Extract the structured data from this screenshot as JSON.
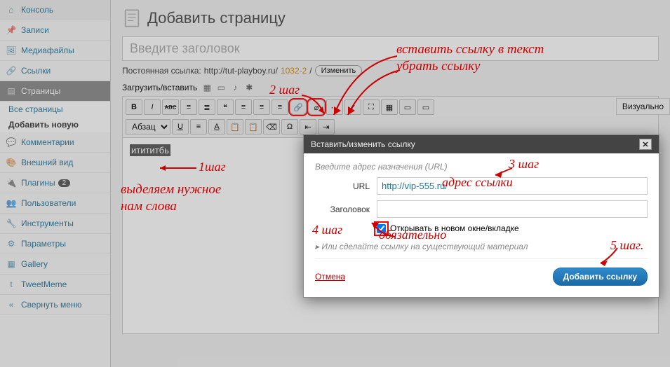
{
  "sidebar": {
    "items": [
      {
        "label": "Консоль",
        "icon": "dashboard"
      },
      {
        "label": "Записи",
        "icon": "pin"
      },
      {
        "label": "Медиафайлы",
        "icon": "media"
      },
      {
        "label": "Ссылки",
        "icon": "link"
      },
      {
        "label": "Страницы",
        "icon": "page",
        "active": true
      },
      {
        "label": "Комментарии",
        "icon": "comment"
      },
      {
        "label": "Внешний вид",
        "icon": "appearance"
      },
      {
        "label": "Плагины",
        "icon": "plugin",
        "badge": "2"
      },
      {
        "label": "Пользователи",
        "icon": "users"
      },
      {
        "label": "Инструменты",
        "icon": "tools"
      },
      {
        "label": "Параметры",
        "icon": "settings"
      },
      {
        "label": "Gallery",
        "icon": "gallery"
      },
      {
        "label": "TweetMeme",
        "icon": "tweet"
      },
      {
        "label": "Свернуть меню",
        "icon": "collapse"
      }
    ],
    "subs": [
      "Все страницы",
      "Добавить новую"
    ]
  },
  "page": {
    "title": "Добавить страницу",
    "title_placeholder": "Введите заголовок",
    "permalink_label": "Постоянная ссылка:",
    "permalink_base": "http://tut-playboy.ru/",
    "permalink_slug": "1032-2",
    "permalink_sep": "/",
    "edit_btn": "Изменить",
    "upload_label": "Загрузить/вставить",
    "tab_visual": "Визуально",
    "format_select": "Абзац",
    "selected_text": "итититбь"
  },
  "modal": {
    "title": "Вставить/изменить ссылку",
    "hint": "Введите адрес назначения (URL)",
    "url_label": "URL",
    "url_value": "http://vip-555.ru/",
    "title_label": "Заголовок",
    "title_value": "",
    "newtab_label": "Открывать в новом окне/вкладке",
    "existing": "Или сделайте ссылку на существующий материал",
    "cancel": "Отмена",
    "submit": "Добавить ссылку"
  },
  "annotations": {
    "step1": "1шаг",
    "step1_text1": "выделяем нужное",
    "step1_text2": "нам слова",
    "step2": "2 шаг",
    "top1": "вставить ссылку в текст",
    "top2": "убрать ссылку",
    "step3": "3 шаг",
    "step3_text": "адрес ссылки",
    "step4": "4 шаг",
    "step4_text": "обязательно",
    "step5": "5 шаг."
  }
}
